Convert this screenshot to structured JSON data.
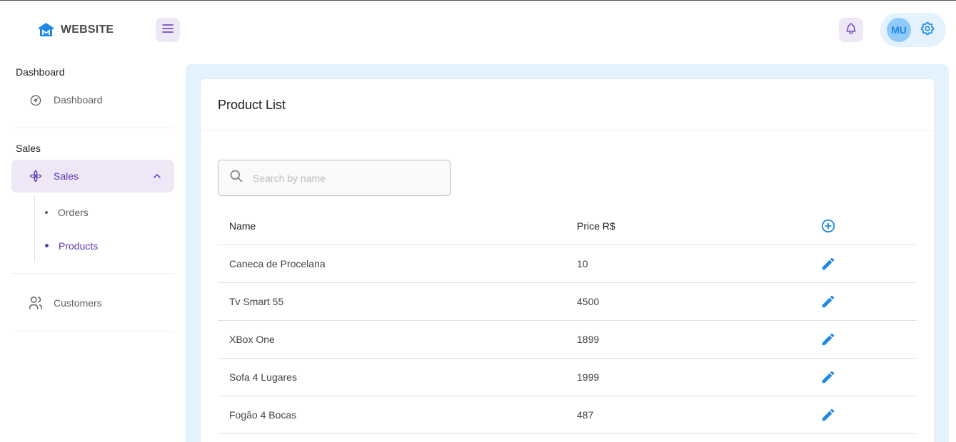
{
  "header": {
    "logo_text": "WEBSITE",
    "logo_icon": "house-logo-icon",
    "menu_icon": "hamburger-menu-icon",
    "notification_icon": "bell-icon",
    "avatar_initials": "MU",
    "settings_icon": "gear-icon"
  },
  "sidebar": {
    "sections": [
      {
        "caption": "Dashboard"
      },
      {
        "caption": "Sales"
      }
    ],
    "items": {
      "dashboard": {
        "label": "Dashboard",
        "icon": "dashboard-gauge-icon"
      },
      "sales": {
        "label": "Sales",
        "icon": "windmill-icon",
        "expanded": true
      },
      "orders": {
        "label": "Orders"
      },
      "products": {
        "label": "Products",
        "active": true
      },
      "customers": {
        "label": "Customers",
        "icon": "users-icon"
      }
    }
  },
  "main": {
    "title": "Product List",
    "search": {
      "placeholder": "Search by name",
      "value": ""
    },
    "columns": {
      "name": "Name",
      "price": "Price R$"
    },
    "add_icon": "add-circle-icon",
    "edit_icon": "pencil-icon",
    "products": [
      {
        "name": "Caneca de Procelana",
        "price": "10"
      },
      {
        "name": "Tv Smart 55",
        "price": "4500"
      },
      {
        "name": "XBox One",
        "price": "1899"
      },
      {
        "name": "Sofa 4 Lugares",
        "price": "1999"
      },
      {
        "name": "Fogão 4 Bocas",
        "price": "487"
      }
    ]
  },
  "colors": {
    "accent_purple": "#5e35b1",
    "accent_light_purple": "#ede7f6",
    "accent_blue": "#1e88e5",
    "light_blue": "#e3f2fd"
  }
}
